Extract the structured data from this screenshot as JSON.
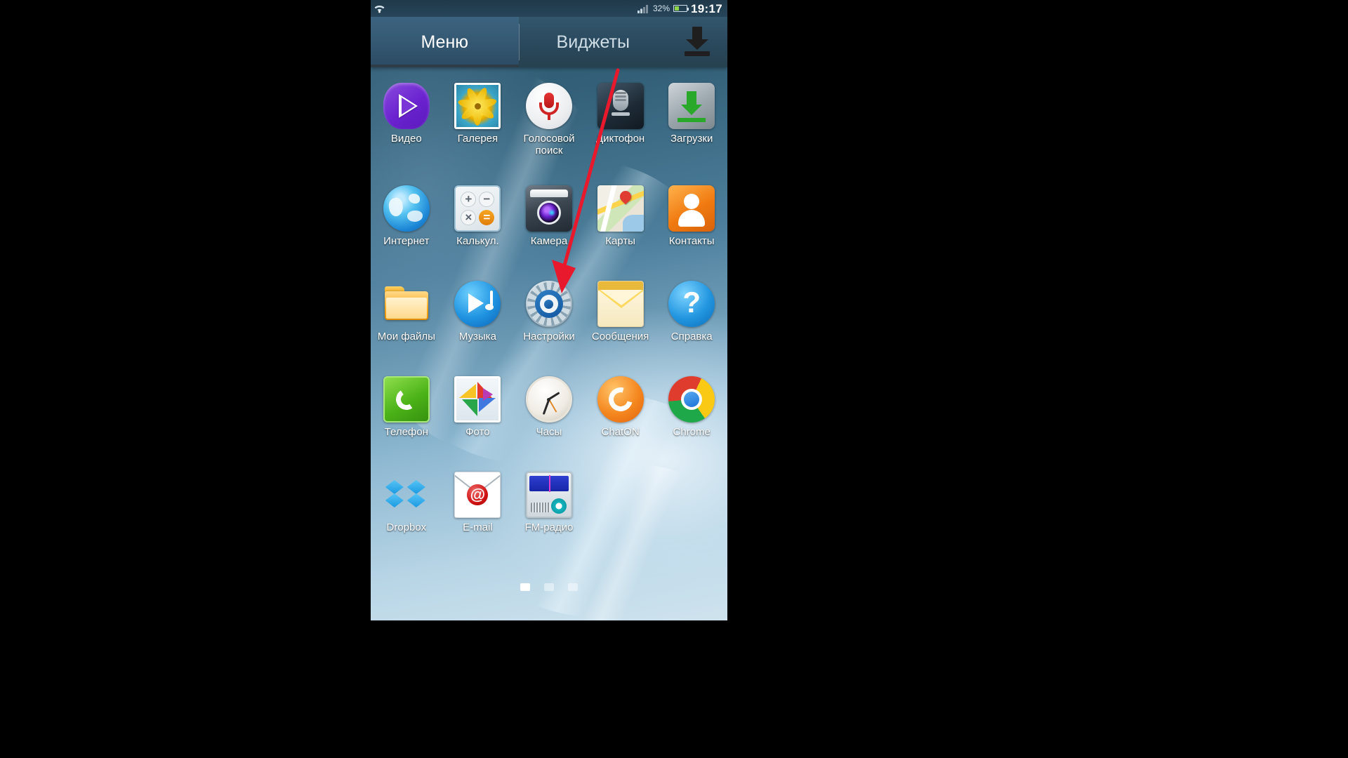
{
  "status_bar": {
    "wifi_icon": "wifi-icon",
    "signal_icon": "signal-bars-icon",
    "battery_percent": "32%",
    "battery_level": 32,
    "time": "19:17"
  },
  "tabs": {
    "menu_label": "Меню",
    "widgets_label": "Виджеты",
    "download_icon": "download-icon",
    "active": "Меню"
  },
  "apps": [
    [
      {
        "label": "Видео",
        "icon": "video-player-icon"
      },
      {
        "label": "Галерея",
        "icon": "gallery-icon"
      },
      {
        "label": "Голосовой поиск",
        "icon": "voice-search-icon"
      },
      {
        "label": "Диктофон",
        "icon": "voice-recorder-icon"
      },
      {
        "label": "Загрузки",
        "icon": "downloads-icon"
      }
    ],
    [
      {
        "label": "Интернет",
        "icon": "internet-browser-icon"
      },
      {
        "label": "Калькул.",
        "icon": "calculator-icon"
      },
      {
        "label": "Камера",
        "icon": "camera-icon"
      },
      {
        "label": "Карты",
        "icon": "maps-icon"
      },
      {
        "label": "Контакты",
        "icon": "contacts-icon"
      }
    ],
    [
      {
        "label": "Мои файлы",
        "icon": "my-files-folder-icon"
      },
      {
        "label": "Музыка",
        "icon": "music-player-icon"
      },
      {
        "label": "Настройки",
        "icon": "settings-gear-icon"
      },
      {
        "label": "Сообщения",
        "icon": "messaging-envelope-icon"
      },
      {
        "label": "Справка",
        "icon": "help-question-icon"
      }
    ],
    [
      {
        "label": "Телефон",
        "icon": "phone-dialer-icon"
      },
      {
        "label": "Фото",
        "icon": "photos-pinwheel-icon"
      },
      {
        "label": "Часы",
        "icon": "clock-icon"
      },
      {
        "label": "ChatON",
        "icon": "chaton-icon"
      },
      {
        "label": "Chrome",
        "icon": "chrome-icon"
      }
    ],
    [
      {
        "label": "Dropbox",
        "icon": "dropbox-icon"
      },
      {
        "label": "E-mail",
        "icon": "email-at-icon"
      },
      {
        "label": "FM-радио",
        "icon": "fm-radio-icon"
      }
    ]
  ],
  "annotation": {
    "arrow_color": "#e8192c",
    "points_to": "Настройки"
  },
  "pager": {
    "pages": 3,
    "current": 1
  },
  "help_glyph": "?",
  "email_glyph": "@",
  "calculator_keys": {
    "plus": "+",
    "minus": "−",
    "times": "×",
    "equals": "="
  }
}
